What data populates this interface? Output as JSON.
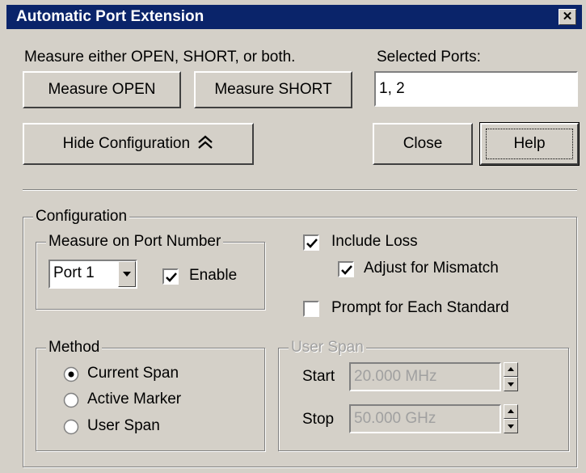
{
  "window": {
    "title": "Automatic Port Extension"
  },
  "instructions": "Measure either OPEN, SHORT, or both.",
  "buttons": {
    "measure_open": "Measure OPEN",
    "measure_short": "Measure SHORT",
    "hide_config": "Hide  Configuration",
    "close": "Close",
    "help": "Help"
  },
  "selected_ports": {
    "label": "Selected Ports:",
    "value": "1, 2"
  },
  "config": {
    "title": "Configuration",
    "port_group": {
      "title": "Measure on Port Number",
      "port_value": "Port 1",
      "enable_label": "Enable",
      "enable_checked": true
    },
    "include_loss": {
      "label": "Include Loss",
      "checked": true
    },
    "adjust_mismatch": {
      "label": "Adjust for Mismatch",
      "checked": true
    },
    "prompt_each": {
      "label": "Prompt for Each Standard",
      "checked": false
    },
    "method": {
      "title": "Method",
      "options": [
        "Current Span",
        "Active Marker",
        "User Span"
      ],
      "selected": "Current Span"
    },
    "user_span": {
      "title": "User Span",
      "start_label": "Start",
      "start_value": "20.000 MHz",
      "stop_label": "Stop",
      "stop_value": "50.000 GHz",
      "enabled": false
    }
  },
  "icons": {
    "close": "close-icon",
    "collapse": "double-chevron-up-icon",
    "dropdown": "chevron-down-icon"
  }
}
